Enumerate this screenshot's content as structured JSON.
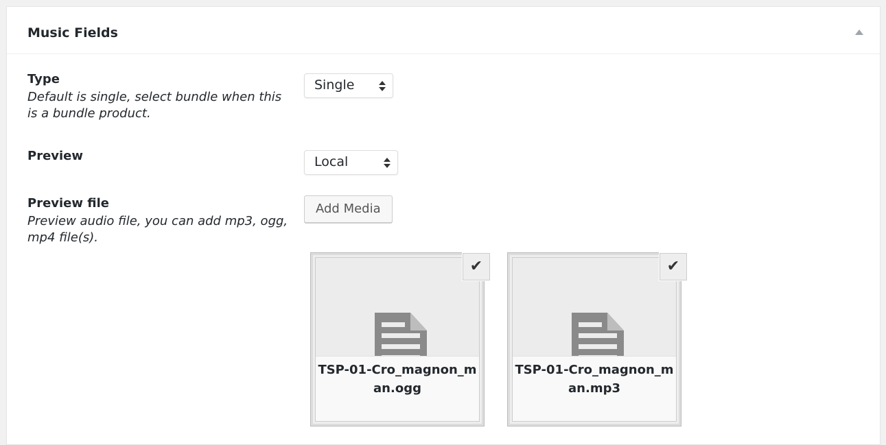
{
  "metabox": {
    "title": "Music Fields"
  },
  "fields": {
    "type": {
      "label": "Type",
      "description": "Default is single, select bundle when this is a bundle product.",
      "selected": "Single"
    },
    "preview": {
      "label": "Preview",
      "selected": "Local"
    },
    "preview_file": {
      "label": "Preview file",
      "description": "Preview audio file, you can add mp3, ogg, mp4 file(s).",
      "button_label": "Add Media"
    }
  },
  "attachments": [
    {
      "filename": "TSP-01-Cro_magnon_man.ogg",
      "check_icon": "✔"
    },
    {
      "filename": "TSP-01-Cro_magnon_man.mp3",
      "check_icon": "✔"
    }
  ],
  "icons": {
    "toggle": "triangle-up-icon",
    "document": "document-icon",
    "check": "checkmark-icon"
  }
}
